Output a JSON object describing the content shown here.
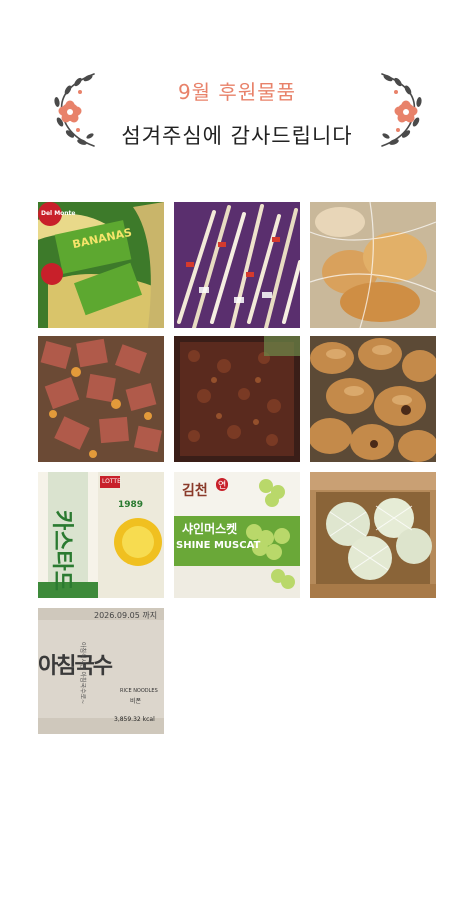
{
  "header": {
    "title": "9월 후원물품",
    "subtitle": "섬겨주심에 감사드립니다"
  },
  "photos": {
    "bananas": {
      "brand": "Del Monte",
      "label": "BANANAS"
    },
    "snack": {
      "brand": "LOTTE",
      "label": "카스타드",
      "year": "1989"
    },
    "grapes": {
      "brand": "김천",
      "brand_suffix": "연",
      "label": "샤인머스켓",
      "label_en": "SHINE MUSCAT"
    },
    "noodles": {
      "date": "2026.09.05 까지",
      "label": "아침국수",
      "slogan": "아침식사는 아침국수로~",
      "product": "RICE NOODLES",
      "product_kr": "비폰",
      "calories": "3,859.32 kcal"
    }
  },
  "colors": {
    "accent": "#e8826a",
    "text": "#222222"
  }
}
